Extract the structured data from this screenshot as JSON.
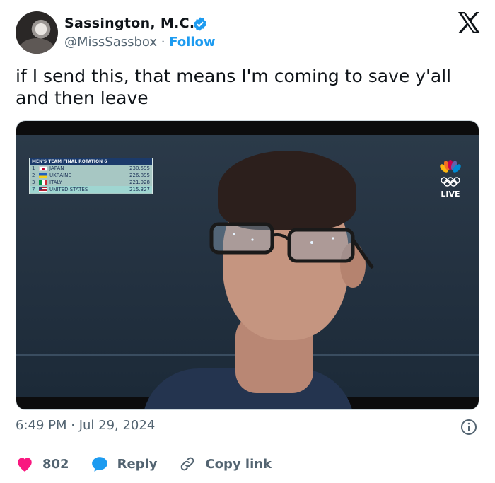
{
  "author": {
    "display_name": "Sassington, M.C.",
    "handle": "@MissSassbox",
    "separator": "·",
    "follow_label": "Follow"
  },
  "tweet": {
    "text": "if I send this, that means I'm coming to save y'all and then leave",
    "timestamp": "6:49 PM · Jul 29, 2024"
  },
  "media": {
    "scoreboard": {
      "header": "MEN'S TEAM FINAL  ROTATION 6",
      "rows": [
        {
          "rank": "1",
          "country": "JAPAN",
          "score": "230.595"
        },
        {
          "rank": "2",
          "country": "UKRAINE",
          "score": "226.895"
        },
        {
          "rank": "3",
          "country": "ITALY",
          "score": "221.928"
        },
        {
          "rank": "7",
          "country": "UNITED STATES",
          "score": "215.327"
        }
      ]
    },
    "broadcaster_badge": "LIVE"
  },
  "actions": {
    "like_count": "802",
    "reply_label": "Reply",
    "copy_link_label": "Copy link"
  },
  "colors": {
    "accent": "#1d9bf0",
    "like": "#f91880",
    "text_secondary": "#536471"
  },
  "icons": [
    "verified-badge-icon",
    "x-logo-icon",
    "info-icon",
    "heart-icon",
    "reply-bubble-icon",
    "link-icon"
  ]
}
